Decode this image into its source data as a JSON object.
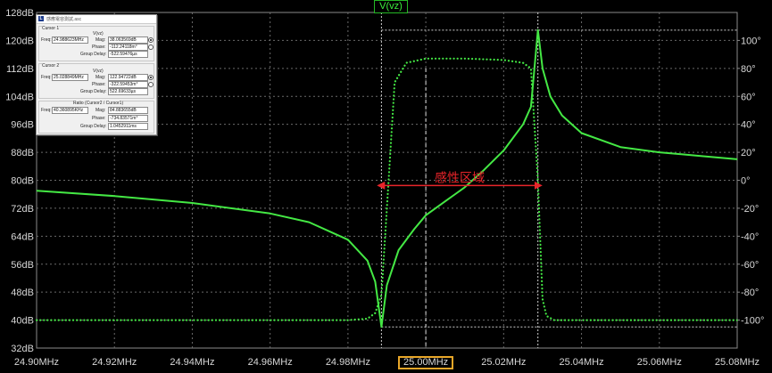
{
  "trace_title": "V(vz)",
  "annotation": {
    "label": "感性区域",
    "color": "#e8242a"
  },
  "colors": {
    "trace": "#44e844",
    "grid": "#6a6a6a",
    "background": "#000000",
    "highlight": "#e8a628"
  },
  "cursor_panel": {
    "title": "感應電容測試.asc",
    "cursor1": {
      "label": "Cursor 1",
      "signal": "V(vz)",
      "freq_label": "Freq:",
      "freq": "24.988623MHz",
      "mag_label": "Mag:",
      "mag": "38.063569dB",
      "phase_label": "Phase:",
      "phase": "-112.24118m°",
      "gd_label": "Group Delay:",
      "gd": "-522.59476µs"
    },
    "cursor2": {
      "label": "Cursor 2",
      "signal": "V(vz)",
      "freq_label": "Freq:",
      "freq": "25.028849MHz",
      "mag_label": "Mag:",
      "mag": "122.94722dB",
      "phase_label": "Phase:",
      "phase": "-322.59453m°",
      "gd_label": "Group Delay:",
      "gd": "522.69633µs"
    },
    "ratio": {
      "label": "Ratio (Cursor2 / Cursor1)",
      "freq_label": "Freq:",
      "freq": "40.360895KHz",
      "mag_label": "Mag:",
      "mag": "84.883655dB",
      "phase_label": "Phase:",
      "phase": "-734.83571m°",
      "gd_label": "Group Delay:",
      "gd": "1.0452911ms"
    }
  },
  "chart_data": {
    "type": "line",
    "xlabel": "",
    "ylabel": "",
    "x_ticks": [
      "24.90MHz",
      "24.92MHz",
      "24.94MHz",
      "24.96MHz",
      "24.98MHz",
      "25.00MHz",
      "25.02MHz",
      "25.04MHz",
      "25.06MHz",
      "25.08MHz"
    ],
    "x_highlighted_tick": "25.00MHz",
    "xlim": [
      24.9,
      25.08
    ],
    "y_left_ticks": [
      "32dB",
      "40dB",
      "48dB",
      "56dB",
      "64dB",
      "72dB",
      "80dB",
      "88dB",
      "96dB",
      "104dB",
      "112dB",
      "120dB",
      "128dB"
    ],
    "ylim_left": [
      32,
      128
    ],
    "y_right_ticks": [
      "-100°",
      "-80°",
      "-60°",
      "-40°",
      "-20°",
      "0°",
      "20°",
      "40°",
      "60°",
      "80°",
      "100°"
    ],
    "ylim_right": [
      -120,
      120
    ],
    "grid": true,
    "cursors_mhz": [
      24.9886,
      25.0288
    ],
    "cursor_y_levels_db": [
      38.06,
      122.95
    ],
    "series": [
      {
        "axis": "left",
        "style": "solid",
        "x": [
          24.9,
          24.92,
          24.94,
          24.96,
          24.97,
          24.98,
          24.985,
          24.987,
          24.9886,
          24.99,
          24.993,
          24.997,
          25.0,
          25.005,
          25.01,
          25.015,
          25.02,
          25.025,
          25.027,
          25.0288,
          25.03,
          25.032,
          25.035,
          25.04,
          25.05,
          25.06,
          25.07,
          25.08
        ],
        "y": [
          77,
          75.5,
          73.5,
          70.5,
          68,
          63,
          57,
          51,
          38.06,
          50,
          60,
          66,
          70,
          74,
          78,
          83,
          88.5,
          96,
          101,
          122.95,
          112,
          104,
          98.5,
          93.5,
          89.5,
          88,
          87,
          86
        ]
      },
      {
        "axis": "right",
        "style": "dotted",
        "x": [
          24.9,
          24.96,
          24.98,
          24.985,
          24.987,
          24.9886,
          24.99,
          24.992,
          24.995,
          25.0,
          25.01,
          25.02,
          25.025,
          25.027,
          25.0288,
          25.03,
          25.031,
          25.033,
          25.04,
          25.06,
          25.08
        ],
        "y": [
          -100,
          -100,
          -100,
          -99,
          -95,
          -82,
          -20,
          70,
          84,
          87,
          87,
          86,
          84,
          80,
          0,
          -85,
          -97,
          -100,
          -100,
          -100,
          -100
        ]
      }
    ]
  }
}
